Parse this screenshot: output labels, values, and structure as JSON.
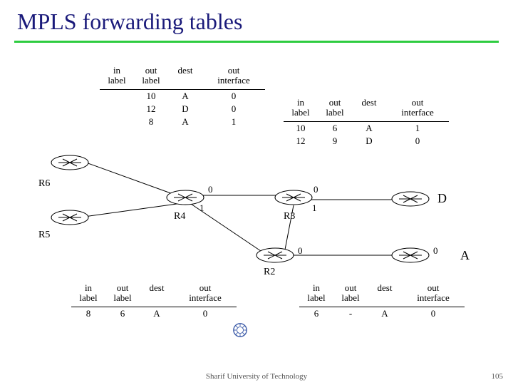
{
  "title": "MPLS forwarding tables",
  "headers": {
    "in_label": "in\nlabel",
    "out_label": "out\nlabel",
    "dest": "dest",
    "out_if": "out\ninterface"
  },
  "tables": {
    "t1": {
      "rows": [
        {
          "in": "",
          "out": "10",
          "dest": "A",
          "if": "0"
        },
        {
          "in": "",
          "out": "12",
          "dest": "D",
          "if": "0"
        },
        {
          "in": "",
          "out": "8",
          "dest": "A",
          "if": "1"
        }
      ]
    },
    "t2": {
      "rows": [
        {
          "in": "10",
          "out": "6",
          "dest": "A",
          "if": "1"
        },
        {
          "in": "12",
          "out": "9",
          "dest": "D",
          "if": "0"
        }
      ]
    },
    "t3": {
      "rows": [
        {
          "in": "8",
          "out": "6",
          "dest": "A",
          "if": "0"
        }
      ]
    },
    "t4": {
      "rows": [
        {
          "in": "6",
          "out": "-",
          "dest": "A",
          "if": "0"
        }
      ]
    }
  },
  "routers": {
    "r6": "R6",
    "r5": "R5",
    "r4": "R4",
    "r3": "R3",
    "r2": "R2"
  },
  "ports": {
    "r4_0": "0",
    "r4_1": "1",
    "r3_0": "0",
    "r3_1": "1",
    "r2_0": "0",
    "rA_0": "0"
  },
  "dests": {
    "D": "D",
    "A": "A"
  },
  "footer": "Sharif University of Technology",
  "page": "105"
}
